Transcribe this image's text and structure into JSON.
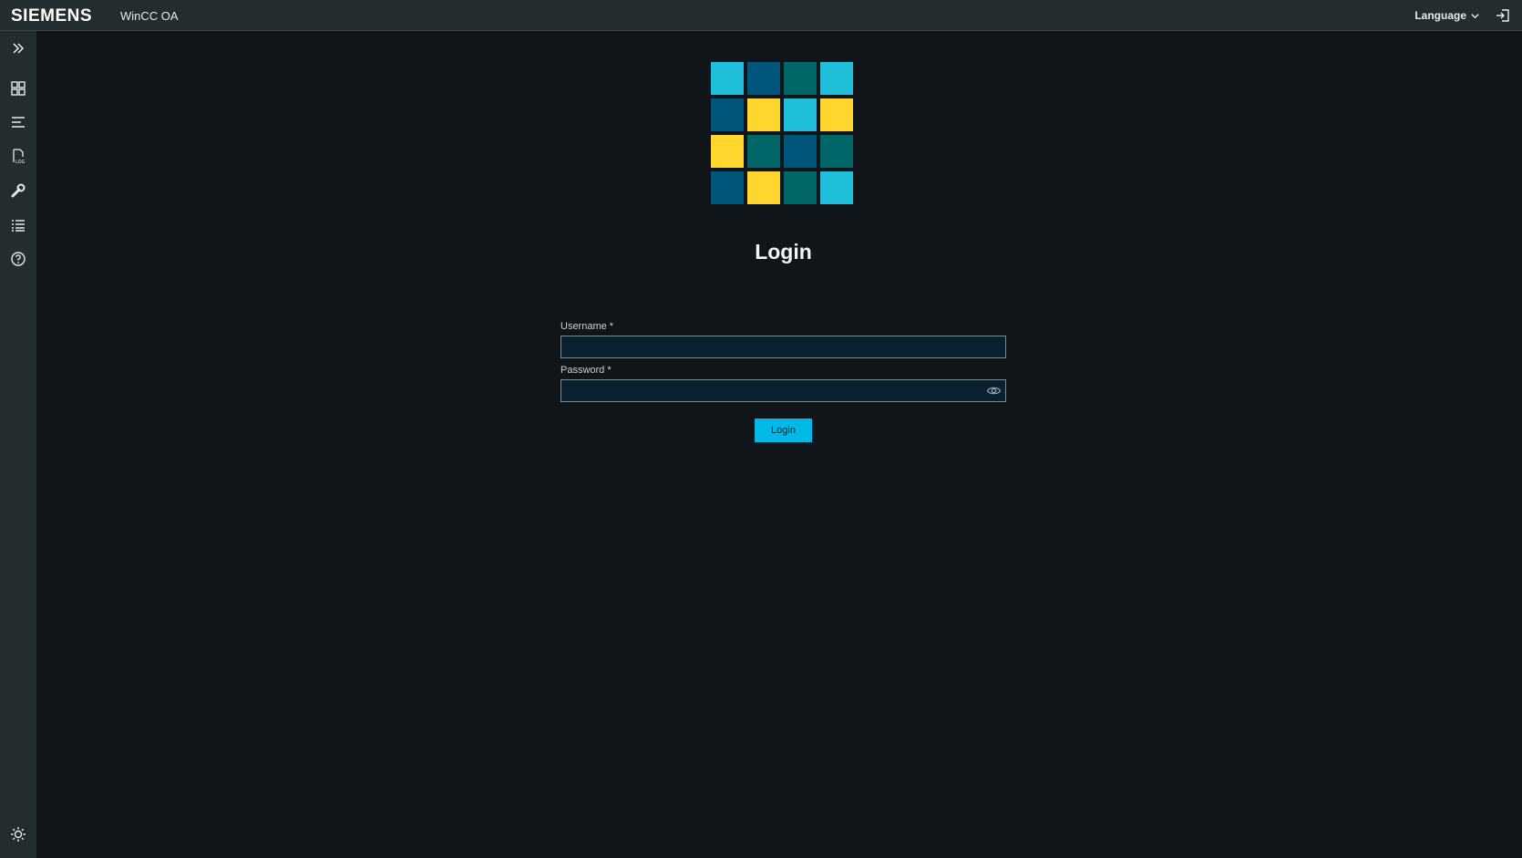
{
  "header": {
    "brand": "SIEMENS",
    "app_name": "WinCC OA",
    "language_label": "Language",
    "logout_icon": "logout-icon"
  },
  "sidebar": {
    "items": [
      {
        "icon": "expand-chevrons-icon"
      },
      {
        "icon": "dashboard-grid-icon"
      },
      {
        "icon": "menu-lines-icon"
      },
      {
        "icon": "log-file-icon"
      },
      {
        "icon": "wrench-icon"
      },
      {
        "icon": "list-icon"
      },
      {
        "icon": "help-icon"
      },
      {
        "icon": "theme-brightness-icon"
      }
    ]
  },
  "logo": {
    "colors": {
      "cyan": "#1fbfdc",
      "navy": "#00567a",
      "teal": "#006668",
      "yellow": "#ffd62e"
    }
  },
  "login": {
    "title": "Login",
    "username_label": "Username *",
    "username_value": "",
    "password_label": "Password *",
    "password_value": "",
    "submit_label": "Login"
  },
  "colors": {
    "accent": "#00b9e4",
    "background": "#0f1518",
    "bar": "#232d30"
  }
}
